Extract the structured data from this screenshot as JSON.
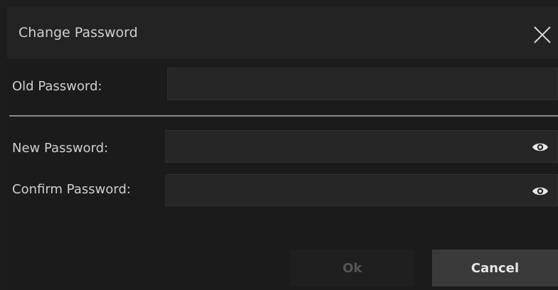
{
  "dialog": {
    "title": "Change Password",
    "close_icon": "close-icon"
  },
  "old_password": {
    "label": "Old Password:",
    "value": "",
    "placeholder": ""
  },
  "new_password": {
    "label": "New Password:",
    "value": "",
    "placeholder": "",
    "toggle_icon": "eye-icon"
  },
  "confirm_password": {
    "label": "Confirm Password:",
    "value": "",
    "placeholder": "",
    "toggle_icon": "eye-icon"
  },
  "buttons": {
    "ok_label": "Ok",
    "cancel_label": "Cancel"
  },
  "colors": {
    "background": "#1b1b1b",
    "titlebar": "#232323",
    "field": "#262626",
    "cancel_button": "#3a3a3a",
    "ok_disabled_text": "#555555",
    "text": "#cfcfcf"
  }
}
